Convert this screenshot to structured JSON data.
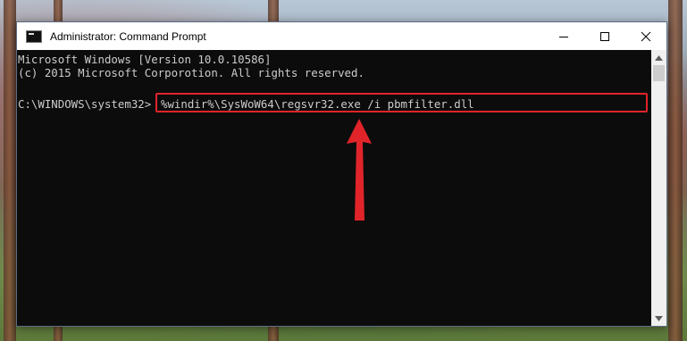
{
  "window": {
    "title": "Administrator: Command Prompt",
    "controls": [
      "minimize",
      "maximize",
      "close"
    ]
  },
  "console": {
    "lines": [
      "Microsoft Windows [Version 10.0.10586]",
      "(c) 2015 Microsoft Corporotion. All rights reserved."
    ],
    "prompt": "C:\\WINDOWS\\system32>",
    "command": "%windir%\\SysWoW64\\regsvr32.exe /i pbmfilter.dll"
  },
  "annotations": {
    "highlight_color": "#e0242a",
    "arrow_color": "#e0242a"
  },
  "icons": {
    "app": "command-prompt-icon",
    "minimize": "minimize-icon",
    "maximize": "maximize-icon",
    "close": "close-icon",
    "scroll_up": "scroll-up-arrow-icon",
    "scroll_down": "scroll-down-arrow-icon",
    "pointer": "red-arrow-icon"
  }
}
